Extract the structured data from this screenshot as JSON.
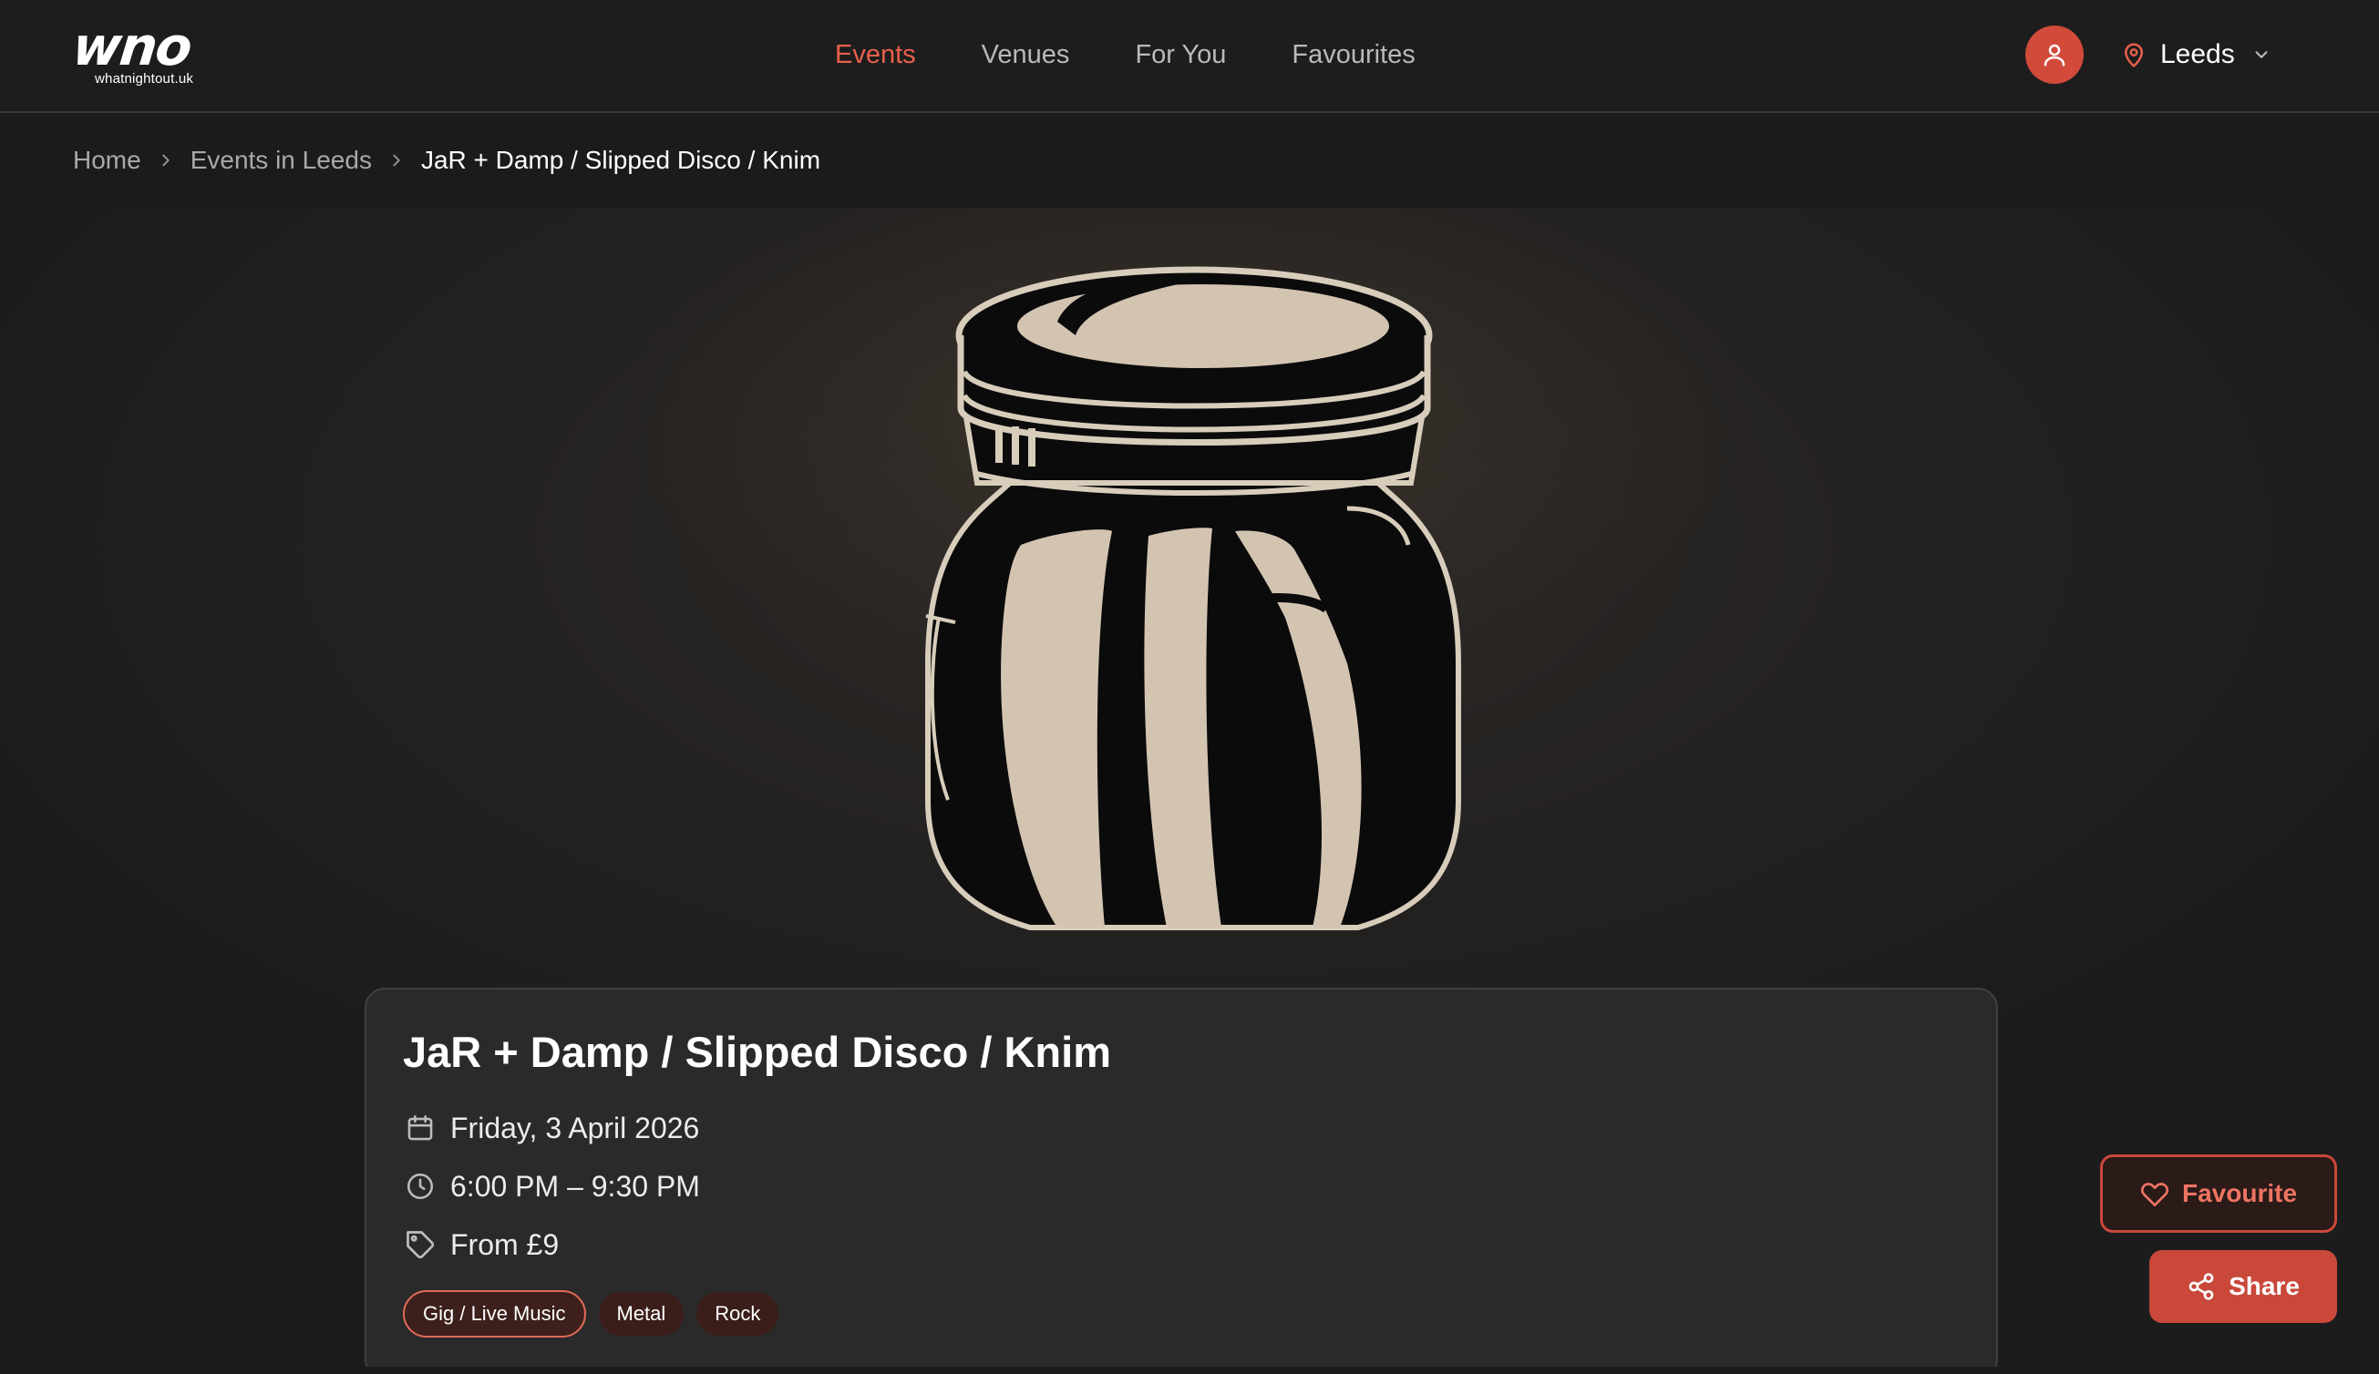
{
  "brand": {
    "logo_mark": "wno",
    "logo_sub": "whatnightout.uk"
  },
  "nav": {
    "items": [
      {
        "label": "Events",
        "active": true
      },
      {
        "label": "Venues",
        "active": false
      },
      {
        "label": "For You",
        "active": false
      },
      {
        "label": "Favourites",
        "active": false
      }
    ]
  },
  "header": {
    "location": "Leeds",
    "icons": [
      "user-icon",
      "map-pin-icon",
      "chevron-down-icon"
    ]
  },
  "breadcrumb": {
    "items": [
      "Home",
      "Events in Leeds",
      "JaR + Damp / Slipped Disco / Knim"
    ]
  },
  "event": {
    "title": "JaR + Damp / Slipped Disco / Knim",
    "date": "Friday, 3 April 2026",
    "time": "6:00 PM – 9:30 PM",
    "price": "From £9",
    "tags": [
      "Gig / Live Music",
      "Metal",
      "Rock"
    ]
  },
  "actions": {
    "favourite_label": "Favourite",
    "share_label": "Share"
  },
  "colors": {
    "accent": "#e8604c",
    "button_red": "#c9483a",
    "background": "#1c1b1b",
    "card": "#2b2a2a"
  }
}
